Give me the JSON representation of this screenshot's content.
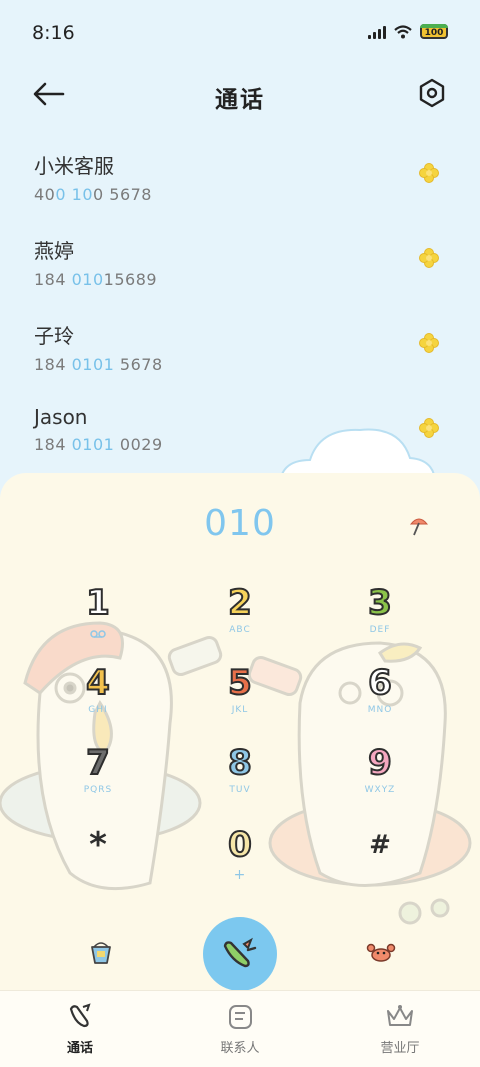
{
  "status_bar": {
    "time": "8:16",
    "battery": "100"
  },
  "header": {
    "title": "通话",
    "back_icon": "arrow-left-icon",
    "settings_icon": "hexagon-settings-icon"
  },
  "contacts": [
    {
      "name": "小米客服",
      "number_parts": [
        "40",
        "0",
        " ",
        "10",
        "0 5678"
      ]
    },
    {
      "name": "燕婷",
      "number_parts": [
        "184 ",
        "010",
        "15689",
        "",
        ""
      ]
    },
    {
      "name": "子玲",
      "number_parts": [
        "184 ",
        "0101",
        " 5678",
        "",
        ""
      ]
    },
    {
      "name": "Jason",
      "number_parts": [
        "184 ",
        "0101",
        " 0029",
        "",
        ""
      ]
    }
  ],
  "dialer": {
    "input": "010",
    "keys": [
      {
        "digit": "1",
        "letters": "",
        "color": "#ffffff"
      },
      {
        "digit": "2",
        "letters": "ABC",
        "color": "#f6d35b"
      },
      {
        "digit": "3",
        "letters": "DEF",
        "color": "#8bc34a"
      },
      {
        "digit": "4",
        "letters": "GHI",
        "color": "#f2c14e"
      },
      {
        "digit": "5",
        "letters": "JKL",
        "color": "#e8704a"
      },
      {
        "digit": "6",
        "letters": "MNO",
        "color": "#ffffff"
      },
      {
        "digit": "7",
        "letters": "PQRS",
        "color": "#6d6d6d"
      },
      {
        "digit": "8",
        "letters": "TUV",
        "color": "#8fc7e6"
      },
      {
        "digit": "9",
        "letters": "WXYZ",
        "color": "#f4a7c0"
      },
      {
        "digit": "*",
        "letters": "",
        "color": "#2e2e2e"
      },
      {
        "digit": "0",
        "letters": "+",
        "color": "#f6e6a8"
      },
      {
        "digit": "#",
        "letters": "",
        "color": "#2e2e2e"
      }
    ]
  },
  "bottom_nav": [
    {
      "label": "通话",
      "icon": "phone-icon",
      "active": true
    },
    {
      "label": "联系人",
      "icon": "contacts-icon",
      "active": false
    },
    {
      "label": "营业厅",
      "icon": "crown-icon",
      "active": false
    }
  ],
  "colors": {
    "accent": "#7cc8ef",
    "highlight": "#78c1e9",
    "panel": "#fdf9e8",
    "background": "#e6f4fb"
  }
}
